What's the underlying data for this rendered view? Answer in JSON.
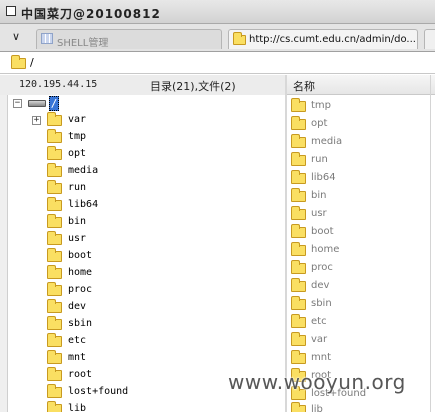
{
  "window": {
    "title": "中国菜刀@20100812"
  },
  "tabs": [
    {
      "label": "SHELL管理",
      "active": false
    },
    {
      "label": "http://cs.cumt.edu.cn/admin/do...",
      "active": true
    }
  ],
  "address": {
    "path": "/"
  },
  "status": {
    "ip": "120.195.44.15",
    "dir_count": "目录(21),文件(2)"
  },
  "tree": {
    "root_label": "/",
    "items": [
      "var",
      "tmp",
      "opt",
      "media",
      "run",
      "lib64",
      "bin",
      "usr",
      "boot",
      "home",
      "proc",
      "dev",
      "sbin",
      "etc",
      "mnt",
      "root",
      "lost+found",
      "lib"
    ]
  },
  "list": {
    "header_name": "名称",
    "items": [
      "tmp",
      "opt",
      "media",
      "run",
      "lib64",
      "bin",
      "usr",
      "boot",
      "home",
      "proc",
      "dev",
      "sbin",
      "etc",
      "var",
      "mnt",
      "root",
      "lost+found",
      "lib"
    ]
  },
  "watermark": "www.wooyun.org",
  "colors": {
    "folder": "#fadf62",
    "selection": "#3875d7",
    "list_text": "#7a7a7a"
  }
}
